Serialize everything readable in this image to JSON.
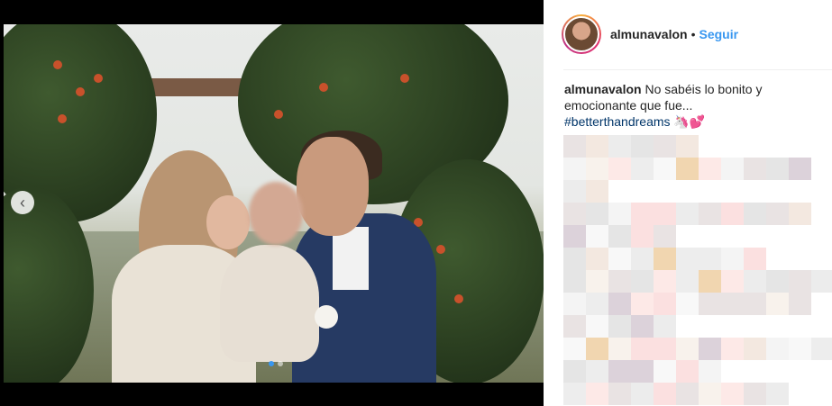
{
  "post": {
    "username": "almunavalon",
    "separator": "•",
    "follow_label": "Seguir",
    "caption_username": "almunavalon",
    "caption_text": "No sabéis lo bonito y emocionante que fue...",
    "hashtag": "#betterthandreams",
    "emoji": "🦄💕"
  },
  "media": {
    "prev_icon": "chevron-left-icon",
    "prev_glyph": "‹",
    "carousel": {
      "count": 2,
      "active": 1
    }
  },
  "colors": {
    "link": "#3897f0",
    "hashtag": "#003569",
    "text": "#262626"
  }
}
